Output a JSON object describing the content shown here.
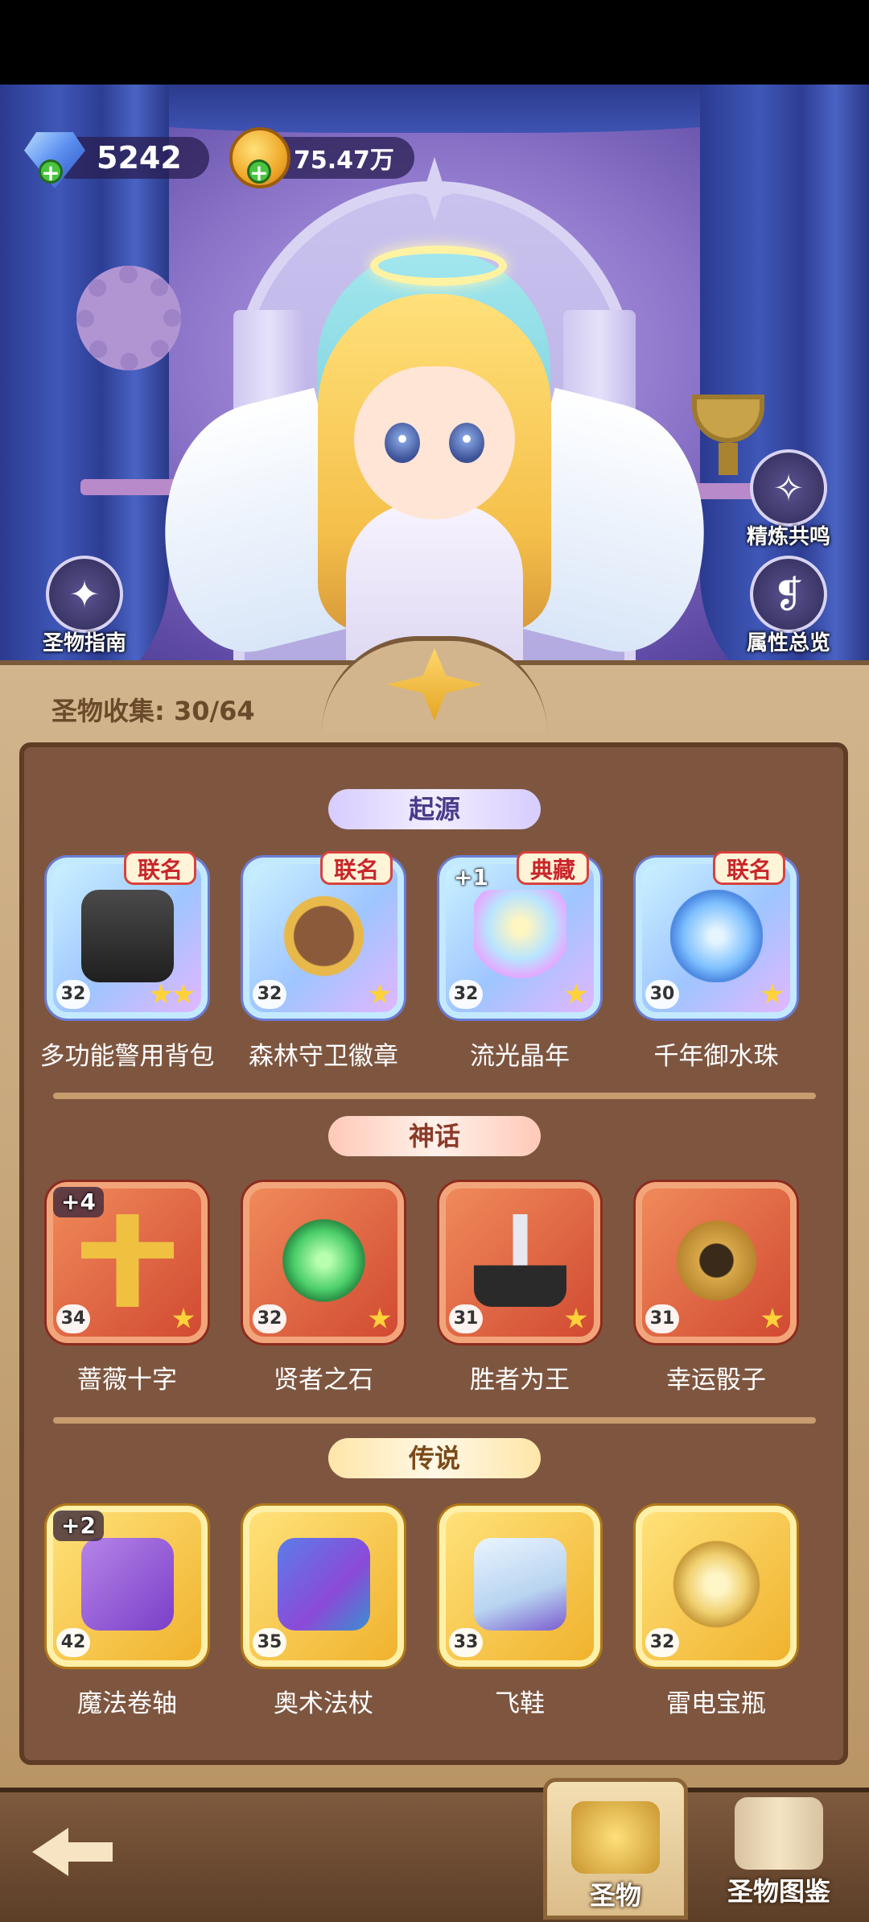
{
  "currency": {
    "gems": "5242",
    "gold": "75.47万",
    "add_symbol": "+"
  },
  "side_buttons": {
    "guide": "圣物指南",
    "refine": "精炼共鸣",
    "attributes": "属性总览"
  },
  "collection": "圣物收集: 30/64",
  "categories": {
    "origin": "起源",
    "myth": "神话",
    "legend": "传说"
  },
  "relics": {
    "origin": [
      {
        "name": "多功能警用背包",
        "level": "32",
        "tag": "联名",
        "plus": "",
        "stars": 2
      },
      {
        "name": "森林守卫徽章",
        "level": "32",
        "tag": "联名",
        "plus": "",
        "stars": 1
      },
      {
        "name": "流光晶年",
        "level": "32",
        "tag": "典藏",
        "plus": "+1",
        "stars": 1
      },
      {
        "name": "千年御水珠",
        "level": "30",
        "tag": "联名",
        "plus": "",
        "stars": 1
      }
    ],
    "myth": [
      {
        "name": "蔷薇十字",
        "level": "34",
        "plus": "+4",
        "stars": 1
      },
      {
        "name": "贤者之石",
        "level": "32",
        "plus": "",
        "stars": 1
      },
      {
        "name": "胜者为王",
        "level": "31",
        "plus": "",
        "stars": 1
      },
      {
        "name": "幸运骰子",
        "level": "31",
        "plus": "",
        "stars": 1
      }
    ],
    "legend": [
      {
        "name": "魔法卷轴",
        "level": "42",
        "plus": "+2"
      },
      {
        "name": "奥术法杖",
        "level": "35",
        "plus": ""
      },
      {
        "name": "飞鞋",
        "level": "33",
        "plus": ""
      },
      {
        "name": "雷电宝瓶",
        "level": "32",
        "plus": ""
      }
    ]
  },
  "nav": {
    "relics": "圣物",
    "codex": "圣物图鉴"
  },
  "colors": {
    "origin_frame": "#9fc5ff",
    "myth_frame": "#d14a32",
    "legend_frame": "#f0b22d"
  }
}
